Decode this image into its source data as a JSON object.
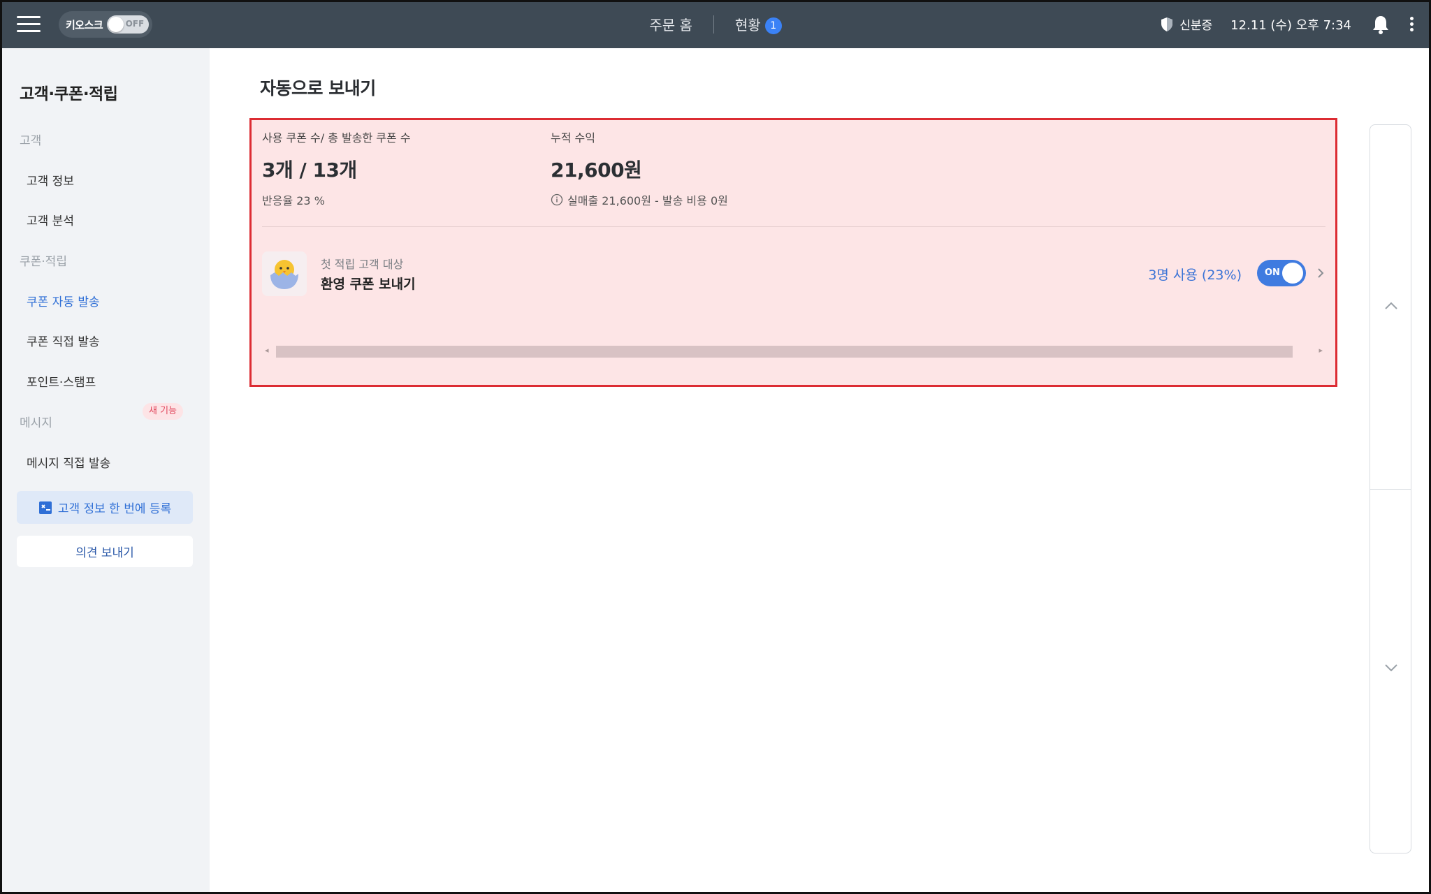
{
  "topbar": {
    "kiosk_label": "키오스크",
    "kiosk_state": "OFF",
    "nav_home": "주문 홈",
    "nav_status": "현황",
    "nav_status_badge": "1",
    "secure_label": "신분증",
    "datetime": "12.11 (수) 오후 7:34"
  },
  "sidebar": {
    "title": "고객·쿠폰·적립",
    "group_customer": "고객",
    "item_customer_info": "고객 정보",
    "item_customer_analysis": "고객 분석",
    "group_coupon": "쿠폰·적립",
    "item_coupon_auto": "쿠폰 자동 발송",
    "item_coupon_direct": "쿠폰 직접 발송",
    "item_point_stamp": "포인트·스탬프",
    "group_message": "메시지",
    "item_message_direct": "메시지 직접 발송",
    "new_badge": "새 기능",
    "register_button": "고객 정보 한 번에 등록",
    "feedback_button": "의견 보내기"
  },
  "main": {
    "title": "자동으로 보내기",
    "stats": {
      "coupons_label": "사용 쿠폰 수/ 총 발송한 쿠폰 수",
      "coupons_value": "3개 / 13개",
      "response_rate": "반응율 23 %",
      "revenue_label": "누적 수익",
      "revenue_value": "21,600원",
      "revenue_detail": "실매출 21,600원 - 발송 비용 0원"
    },
    "coupon": {
      "target": "첫 적립 고객 대상",
      "name": "환영 쿠폰 보내기",
      "usage": "3명 사용 (23%)",
      "toggle": "ON"
    }
  },
  "colors": {
    "topbar": "#3e4a55",
    "accent": "#3f7be0",
    "highlight_fill": "#fde5e6",
    "highlight_border": "#dc2c33"
  },
  "icons": [
    "menu-icon",
    "shield-icon",
    "bell-icon",
    "more-vertical-icon",
    "info-icon",
    "chick-icon",
    "chevron-right-icon",
    "chevron-up-icon",
    "chevron-down-icon",
    "register-icon"
  ]
}
